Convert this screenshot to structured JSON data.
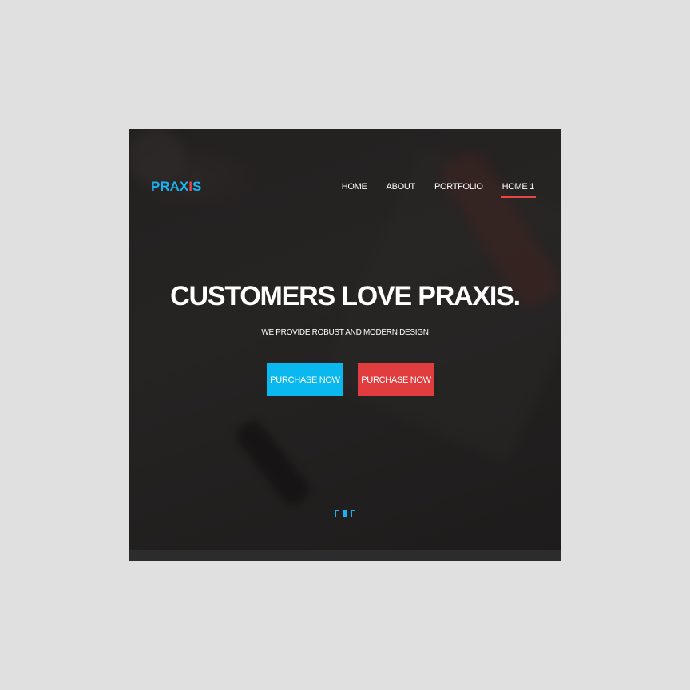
{
  "brand": {
    "logo_part1": "PRAX",
    "logo_part2": "I",
    "logo_part3": "S",
    "logo_color": "#1ab3f2",
    "logo_accent_color": "#e84545"
  },
  "nav": {
    "items": [
      {
        "label": "HOME",
        "active": false
      },
      {
        "label": "ABOUT",
        "active": false
      },
      {
        "label": "PORTFOLIO",
        "active": false
      },
      {
        "label": "HOME 1",
        "active": true
      }
    ],
    "active_indicator_color": "#e84545"
  },
  "hero": {
    "title": "CUSTOMERS LOVE PRAXIS.",
    "subtitle": "WE PROVIDE ROBUST AND MODERN DESIGN",
    "buttons": [
      {
        "label": "PURCHASE NOW",
        "color": "#0ab8f0"
      },
      {
        "label": "PURCHASE NOW",
        "color": "#e13c3e"
      }
    ]
  },
  "slider": {
    "slide_count": 3,
    "active_index": 1
  }
}
